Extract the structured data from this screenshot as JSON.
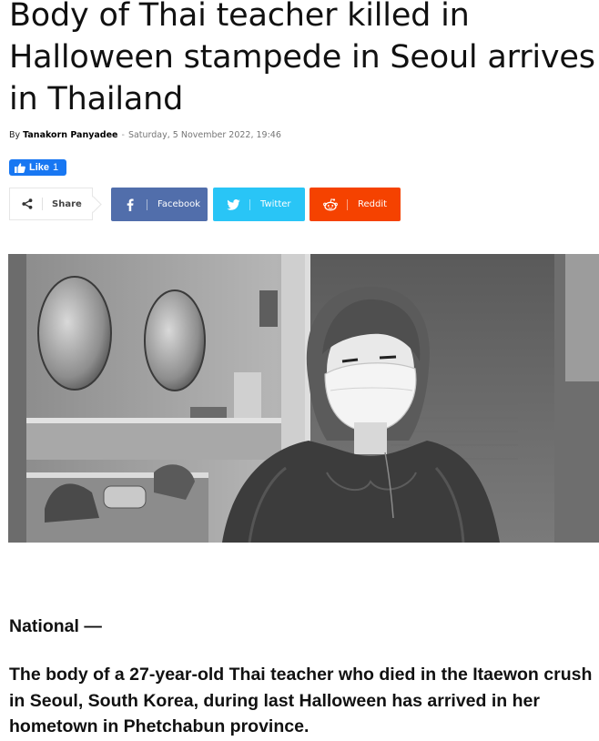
{
  "article": {
    "title": "Body of Thai teacher killed in Halloween stampede in Seoul arrives in Thailand",
    "byline_prefix": "By",
    "author": "Tanakorn Panyadee",
    "separator": "-",
    "date": "Saturday, 5 November 2022, 19:46",
    "section_label": "National —",
    "lead": "The body of a 27-year-old Thai teacher who died in the Itaewon crush in Seoul, South Korea, during last Halloween has arrived in her hometown in Phetchabun province."
  },
  "like_widget": {
    "label": "Like",
    "count": "1",
    "color": "#1877f2"
  },
  "share": {
    "label": "Share",
    "buttons": [
      {
        "label": "Facebook",
        "icon": "facebook-icon",
        "color": "#516eab"
      },
      {
        "label": "Twitter",
        "icon": "twitter-icon",
        "color": "#29c5f6"
      },
      {
        "label": "Reddit",
        "icon": "reddit-icon",
        "color": "#f54200"
      }
    ]
  },
  "image": {
    "style": "grayscale"
  }
}
